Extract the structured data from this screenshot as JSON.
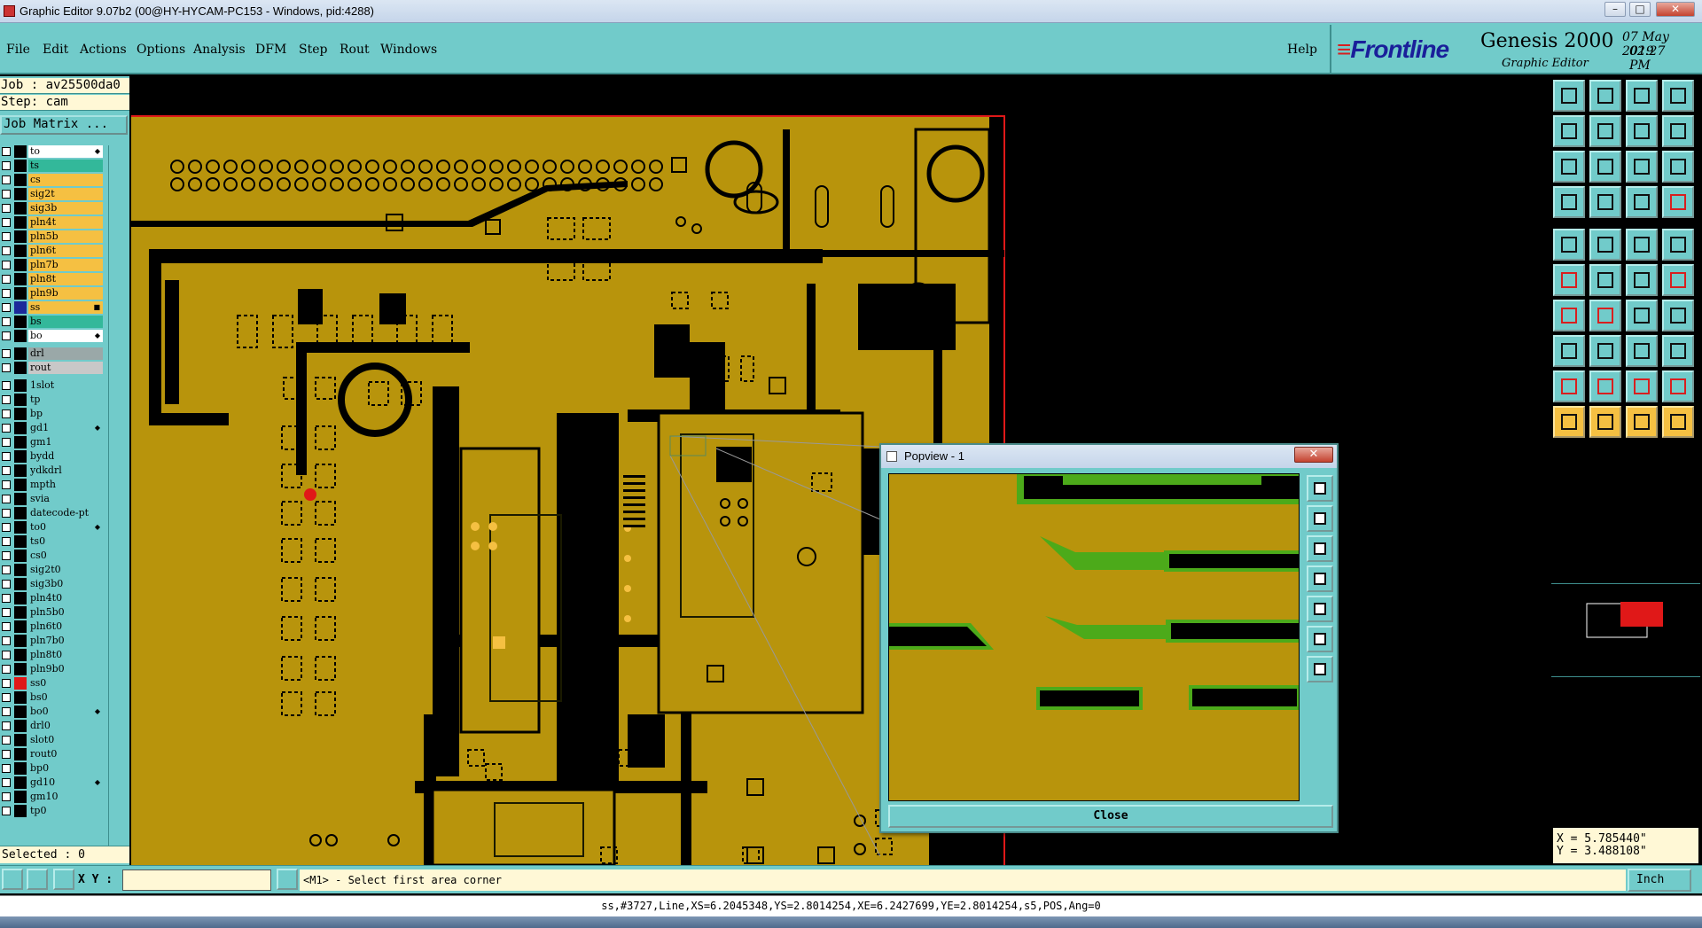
{
  "window": {
    "title": "Graphic Editor 9.07b2 (00@HY-HYCAM-PC153 - Windows, pid:4288)",
    "min": "–",
    "max": "□",
    "close": "✕"
  },
  "menu": {
    "items": [
      "File",
      "Edit",
      "Actions",
      "Options",
      "Analysis",
      "DFM",
      "Step",
      "Rout",
      "Windows"
    ],
    "help": "Help"
  },
  "brand": {
    "logo": "Frontline",
    "product": "Genesis 2000",
    "subtitle": "Graphic Editor",
    "date": "07 May 2019",
    "time": "02:27 PM"
  },
  "job": {
    "job_line": "Job : av25500da0",
    "step_line": "Step: cam",
    "matrix_button": "Job Matrix ...",
    "selected": "Selected : 0"
  },
  "layers": [
    {
      "name": "to",
      "color": "#ffffff",
      "mark": "◆"
    },
    {
      "name": "ts",
      "color": "#33b89a",
      "mark": ""
    },
    {
      "name": "cs",
      "color": "#f5c042",
      "mark": ""
    },
    {
      "name": "sig2t",
      "color": "#f5c042",
      "mark": ""
    },
    {
      "name": "sig3b",
      "color": "#f5c042",
      "mark": ""
    },
    {
      "name": "pln4t",
      "color": "#f5c042",
      "mark": ""
    },
    {
      "name": "pln5b",
      "color": "#f5c042",
      "mark": ""
    },
    {
      "name": "pln6t",
      "color": "#f5c042",
      "mark": ""
    },
    {
      "name": "pln7b",
      "color": "#f5c042",
      "mark": ""
    },
    {
      "name": "pln8t",
      "color": "#f5c042",
      "mark": ""
    },
    {
      "name": "pln9b",
      "color": "#f5c042",
      "mark": ""
    },
    {
      "name": "ss",
      "color": "#f5c042",
      "mark": "■",
      "active": true
    },
    {
      "name": "bs",
      "color": "#33b89a",
      "mark": ""
    },
    {
      "name": "bo",
      "color": "#ffffff",
      "mark": "◆"
    },
    {
      "name": "drl",
      "color": "#9aa8a8",
      "mark": "",
      "gap": true
    },
    {
      "name": "rout",
      "color": "#c8c8c8",
      "mark": ""
    },
    {
      "name": "1slot",
      "color": "#71cbca",
      "mark": "",
      "gap": true
    },
    {
      "name": "tp",
      "color": "#71cbca",
      "mark": ""
    },
    {
      "name": "bp",
      "color": "#71cbca",
      "mark": ""
    },
    {
      "name": "gd1",
      "color": "#71cbca",
      "mark": "◆"
    },
    {
      "name": "gm1",
      "color": "#71cbca",
      "mark": ""
    },
    {
      "name": "bydd",
      "color": "#71cbca",
      "mark": ""
    },
    {
      "name": "ydkdrl",
      "color": "#71cbca",
      "mark": ""
    },
    {
      "name": "mpth",
      "color": "#71cbca",
      "mark": ""
    },
    {
      "name": "svia",
      "color": "#71cbca",
      "mark": ""
    },
    {
      "name": "datecode-pt",
      "color": "#71cbca",
      "mark": ""
    },
    {
      "name": "to0",
      "color": "#71cbca",
      "mark": "◆"
    },
    {
      "name": "ts0",
      "color": "#71cbca",
      "mark": ""
    },
    {
      "name": "cs0",
      "color": "#71cbca",
      "mark": ""
    },
    {
      "name": "sig2t0",
      "color": "#71cbca",
      "mark": ""
    },
    {
      "name": "sig3b0",
      "color": "#71cbca",
      "mark": ""
    },
    {
      "name": "pln4t0",
      "color": "#71cbca",
      "mark": ""
    },
    {
      "name": "pln5b0",
      "color": "#71cbca",
      "mark": ""
    },
    {
      "name": "pln6t0",
      "color": "#71cbca",
      "mark": ""
    },
    {
      "name": "pln7b0",
      "color": "#71cbca",
      "mark": ""
    },
    {
      "name": "pln8t0",
      "color": "#71cbca",
      "mark": ""
    },
    {
      "name": "pln9b0",
      "color": "#71cbca",
      "mark": ""
    },
    {
      "name": "ss0",
      "color": "#71cbca",
      "mark": "",
      "red": true
    },
    {
      "name": "bs0",
      "color": "#71cbca",
      "mark": ""
    },
    {
      "name": "bo0",
      "color": "#71cbca",
      "mark": "◆"
    },
    {
      "name": "drl0",
      "color": "#71cbca",
      "mark": ""
    },
    {
      "name": "slot0",
      "color": "#71cbca",
      "mark": ""
    },
    {
      "name": "rout0",
      "color": "#71cbca",
      "mark": ""
    },
    {
      "name": "bp0",
      "color": "#71cbca",
      "mark": ""
    },
    {
      "name": "gd10",
      "color": "#71cbca",
      "mark": "◆"
    },
    {
      "name": "gm10",
      "color": "#71cbca",
      "mark": ""
    },
    {
      "name": "tp0",
      "color": "#71cbca",
      "mark": ""
    }
  ],
  "popview": {
    "title": "Popview - 1",
    "close_label": "Close",
    "x": "✕"
  },
  "coords": {
    "x": "X = 5.785440\"",
    "y": "Y = 3.488108\""
  },
  "command": {
    "xy_label": "X Y :",
    "xy_value": "",
    "prompt": "<M1> - Select first area corner",
    "units": "Inch"
  },
  "status": {
    "text": "ss,#3727,Line,XS=6.2045348,YS=2.8014254,XE=6.2427699,YE=2.8014254,s5,POS,Ang=0"
  },
  "colors": {
    "panel": "#71cbca",
    "board": "#b8940c",
    "copper_dark": "#000000",
    "highlight": "#4caa1a",
    "profile": "#e01818"
  },
  "tools": {
    "icons": [
      "layer-up-icon",
      "layer-down-icon",
      "home-icon",
      "window-icon",
      "pan-left-icon",
      "pan-right-icon",
      "pan-in-icon",
      "frame-icon",
      "zoom-fit-icon",
      "zoom-center-icon",
      "scale-1to1-icon",
      "help-icon",
      "wrench-icon",
      "grid-icon",
      "snap-icon",
      "snap-red-icon",
      "pad-icon",
      "line-icon",
      "text-icon",
      "circle-icon",
      "net-icon",
      "cross-icon",
      "move-icon",
      "route-icon",
      "angle-icon",
      "slope-icon",
      "arc-icon",
      "ff-icon",
      "square-icon",
      "minus-icon",
      "join-icon",
      "copy-icon",
      "tri-icon",
      "tri2-icon",
      "tri3-icon",
      "tri4-icon",
      "arrow-icon",
      "arrow2-icon",
      "arrow3-icon",
      "arrow4-icon"
    ]
  }
}
